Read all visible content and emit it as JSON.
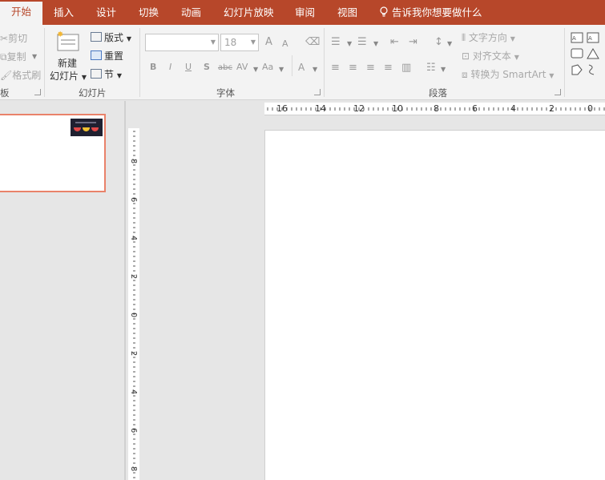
{
  "tabs": [
    {
      "label": "开始",
      "active": true
    },
    {
      "label": "插入"
    },
    {
      "label": "设计"
    },
    {
      "label": "切换"
    },
    {
      "label": "动画"
    },
    {
      "label": "幻灯片放映"
    },
    {
      "label": "审阅"
    },
    {
      "label": "视图"
    }
  ],
  "tellme": {
    "label": "告诉我你想要做什么"
  },
  "clipboard": {
    "cut": "剪切",
    "copy": "复制",
    "format_painter": "格式刷",
    "label": "板"
  },
  "slides": {
    "new_slide_line1": "新建",
    "new_slide_line2": "幻灯片",
    "layout": "版式",
    "reset": "重置",
    "section": "节",
    "label": "幻灯片"
  },
  "font": {
    "name_value": "",
    "size_value": "18",
    "grow": "A",
    "shrink": "A",
    "bold": "B",
    "italic": "I",
    "underline": "U",
    "shadow": "S",
    "strike": "abc",
    "spacing": "AV",
    "case": "Aa",
    "color": "A",
    "label": "字体"
  },
  "paragraph": {
    "text_direction": "文字方向",
    "align_text": "对齐文本",
    "smartart": "转换为 SmartArt",
    "label": "段落"
  },
  "hruler": {
    "labels": [
      "16",
      "14",
      "12",
      "10",
      "8",
      "6",
      "4",
      "2",
      "0"
    ]
  },
  "vruler": {
    "labels": [
      "8",
      "6",
      "4",
      "2",
      "0",
      "2",
      "4",
      "6",
      "8"
    ]
  },
  "colors": {
    "accent": "#b7472a",
    "thumb_border": "#e9826a"
  }
}
